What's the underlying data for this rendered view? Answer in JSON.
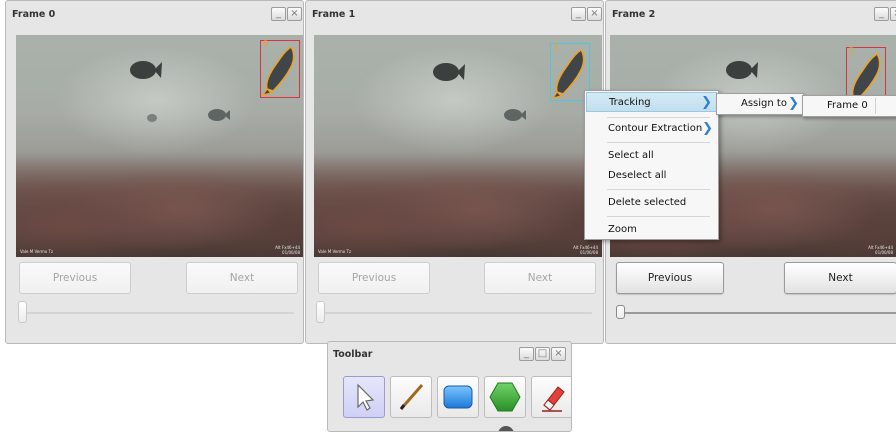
{
  "frames": [
    {
      "title": "Frame 0",
      "box_number": "0",
      "prev_label": "Previous",
      "next_label": "Next",
      "caption_left": "Vale M Vermo Tz",
      "caption_right": "Alt Fx46+44\n01/00/08"
    },
    {
      "title": "Frame 1",
      "box_number": "1",
      "prev_label": "Previous",
      "next_label": "Next",
      "caption_left": "Vale M Vermo Tz",
      "caption_right": "Alt Fx46+44\n01/00/08"
    },
    {
      "title": "Frame 2",
      "box_number": "2",
      "prev_label": "Previous",
      "next_label": "Next",
      "caption_left": "Vale M Vermo Tz",
      "caption_right": "Alt Fx46+44\n01/00/08"
    }
  ],
  "window_buttons": {
    "minimize": "_",
    "maximize": "□",
    "close": "×"
  },
  "context_menu": {
    "items": [
      "Tracking",
      "Contour Extraction",
      "Select all",
      "Deselect all",
      "Delete selected",
      "Zoom"
    ],
    "submenu_assign": "Assign to",
    "submenu_target": "Frame 0"
  },
  "toolbar": {
    "title": "Toolbar",
    "tools": [
      "pointer-tool",
      "pencil-tool",
      "rectangle-tool",
      "polygon-tool",
      "eraser-tool"
    ]
  },
  "colors": {
    "bbox_red": "#d8363c",
    "bbox_cyan": "#4fc6de",
    "contour_orange": "#f0a020",
    "menu_chevron": "#2f7fd3"
  }
}
